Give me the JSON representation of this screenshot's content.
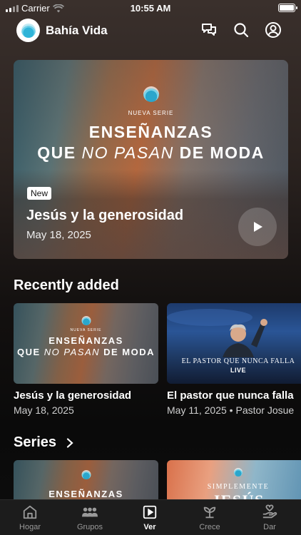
{
  "status_bar": {
    "carrier": "Carrier",
    "time": "10:55 AM"
  },
  "header": {
    "app_title": "Bahía Vida",
    "icons": [
      "chat-bubbles-icon",
      "search-icon",
      "account-icon"
    ]
  },
  "hero": {
    "kicker": "NUEVA SERIE",
    "line1": "ENSEÑANZAS",
    "line2_a": "QUE",
    "line2_b": "NO PASAN",
    "line2_c": "DE MODA",
    "badge": "New",
    "title": "Jesús y la generosidad",
    "date": "May 18, 2025"
  },
  "recently_added": {
    "heading": "Recently added",
    "items": [
      {
        "kicker": "NUEVA SERIE",
        "line1": "ENSEÑANZAS",
        "line2_a": "QUE",
        "line2_b": "NO PASAN",
        "line2_c": "DE MODA",
        "title": "Jesús y la generosidad",
        "meta": "May 18, 2025"
      },
      {
        "overlay": "EL PASTOR QUE NUNCA FALLA",
        "overlay_sub": "LIVE",
        "title": "El pastor que nunca falla",
        "meta": "May 11, 2025 • Pastor Josue"
      }
    ]
  },
  "series": {
    "heading": "Series",
    "items": [
      {
        "line1": "ENSEÑANZAS"
      },
      {
        "kicker": "SIMPLEMENTE",
        "word": "JESÚS"
      }
    ]
  },
  "tabbar": {
    "tabs": [
      {
        "label": "Hogar",
        "icon": "home-icon",
        "active": false
      },
      {
        "label": "Grupos",
        "icon": "groups-icon",
        "active": false
      },
      {
        "label": "Ver",
        "icon": "play-square-icon",
        "active": true
      },
      {
        "label": "Crece",
        "icon": "sprout-icon",
        "active": false
      },
      {
        "label": "Dar",
        "icon": "giving-hand-icon",
        "active": false
      }
    ]
  },
  "colors": {
    "background": "#0d0d0d",
    "tab_bar": "#1c1c1c",
    "accent": "#2aa6cc"
  }
}
